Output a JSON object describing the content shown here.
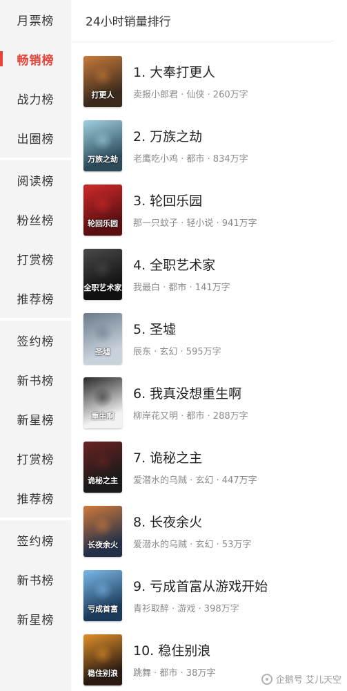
{
  "sidebar": {
    "groups": [
      [
        "月票榜",
        "畅销榜",
        "战力榜",
        "出圈榜"
      ],
      [
        "阅读榜",
        "粉丝榜",
        "打赏榜",
        "推荐榜"
      ],
      [
        "签约榜",
        "新书榜",
        "新星榜",
        "打赏榜",
        "推荐榜"
      ],
      [
        "签约榜",
        "新书榜",
        "新星榜"
      ]
    ],
    "active": "畅销榜",
    "accent": "#e8443a"
  },
  "header": {
    "title": "24小时销量排行"
  },
  "books": [
    {
      "title": "1. 大奉打更人",
      "meta": "卖报小郎君 · 仙侠 · 260万字",
      "cover_text": "打更人",
      "cover_colors": [
        "#3a2a1c",
        "#c87a3a"
      ]
    },
    {
      "title": "2. 万族之劫",
      "meta": "老鹰吃小鸡 · 都市 · 834万字",
      "cover_text": "万族之劫",
      "cover_colors": [
        "#2c4a5a",
        "#9fd0e0"
      ]
    },
    {
      "title": "3. 轮回乐园",
      "meta": "那一只蚊子 · 轻小说 · 941万字",
      "cover_text": "轮回乐园",
      "cover_colors": [
        "#5a0f12",
        "#d02a2a"
      ]
    },
    {
      "title": "4. 全职艺术家",
      "meta": "我最白 · 都市 · 141万字",
      "cover_text": "全职艺术家",
      "cover_colors": [
        "#101010",
        "#4a4a4a"
      ]
    },
    {
      "title": "5. 圣墟",
      "meta": "辰东 · 玄幻 · 595万字",
      "cover_text": "圣墟",
      "cover_colors": [
        "#c8d2dc",
        "#6a7a8a"
      ]
    },
    {
      "title": "6. 我真没想重生啊",
      "meta": "柳岸花又明 · 都市 · 288万字",
      "cover_text": "重生啊",
      "cover_colors": [
        "#f2f2f2",
        "#2a2a2a"
      ]
    },
    {
      "title": "7. 诡秘之主",
      "meta": "爱潜水的乌贼 · 玄幻 · 447万字",
      "cover_text": "诡秘之主",
      "cover_colors": [
        "#1a1a1a",
        "#6a2222"
      ]
    },
    {
      "title": "8. 长夜余火",
      "meta": "爱潜水的乌贼 · 玄幻 · 53万字",
      "cover_text": "长夜余火",
      "cover_colors": [
        "#24304a",
        "#d07a3a"
      ]
    },
    {
      "title": "9. 亏成首富从游戏开始",
      "meta": "青衫取醉 · 游戏 · 398万字",
      "cover_text": "亏成首富",
      "cover_colors": [
        "#1c3a5a",
        "#7ab8e8"
      ]
    },
    {
      "title": "10. 稳住别浪",
      "meta": "跳舞 · 都市 · 38万字",
      "cover_text": "稳住别浪",
      "cover_colors": [
        "#2a1a12",
        "#e0902a"
      ]
    }
  ],
  "watermark": {
    "text": "企鹅号 艾儿天空",
    "icon": "penguin-icon"
  }
}
